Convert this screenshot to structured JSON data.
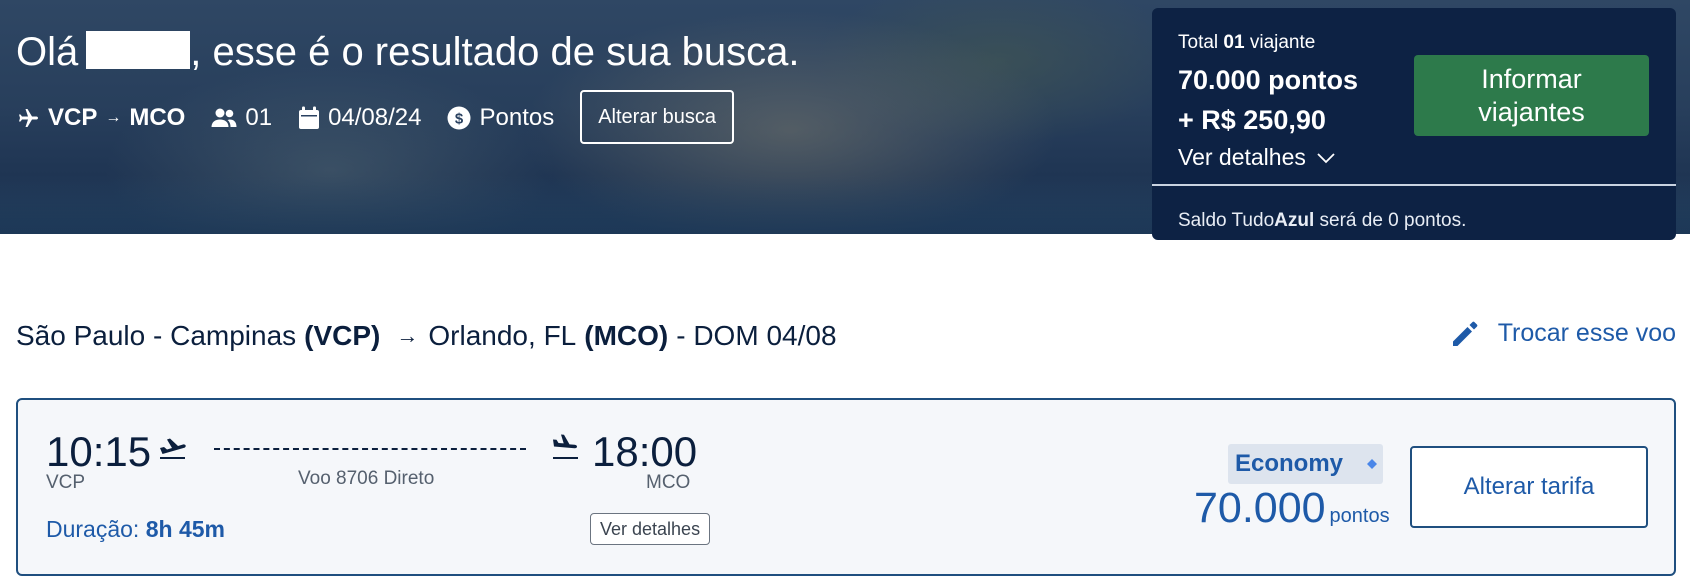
{
  "header": {
    "greeting_prefix": "Olá",
    "greeting_suffix": ", esse é o resultado de sua busca.",
    "origin": "VCP",
    "destination": "MCO",
    "passengers": "01",
    "date": "04/08/24",
    "payment_type": "Pontos",
    "change_search_label": "Alterar busca"
  },
  "summary": {
    "total_prefix": "Total",
    "total_count": "01",
    "total_suffix": "viajante",
    "points_line": "70.000 pontos",
    "money_line": "+ R$ 250,90",
    "details_label": "Ver detalhes",
    "inform_button_line1": "Informar",
    "inform_button_line2": "viajantes",
    "balance_prefix": "Saldo Tudo",
    "balance_brand": "Azul",
    "balance_suffix": " será de 0 pontos."
  },
  "flight_header": {
    "origin_city": "São Paulo - Campinas",
    "origin_code": "(VCP)",
    "dest_city": "Orlando, FL",
    "dest_code": "(MCO)",
    "date_text": "- DOM 04/08",
    "change_flight_label": "Trocar esse voo"
  },
  "flight": {
    "departure_time": "10:15",
    "arrival_time": "18:00",
    "departure_code": "VCP",
    "arrival_code": "MCO",
    "flight_info": "Voo 8706 Direto",
    "duration_label": "Duração:",
    "duration_value": "8h 45m",
    "details_label": "Ver detalhes",
    "fare_class": "Economy",
    "fare_points": "70.000",
    "fare_points_unit": "pontos",
    "change_fare_label": "Alterar tarifa"
  },
  "colors": {
    "navy": "#0d2244",
    "accent_blue": "#1e5aa8",
    "green_button": "#2d7a4b"
  }
}
